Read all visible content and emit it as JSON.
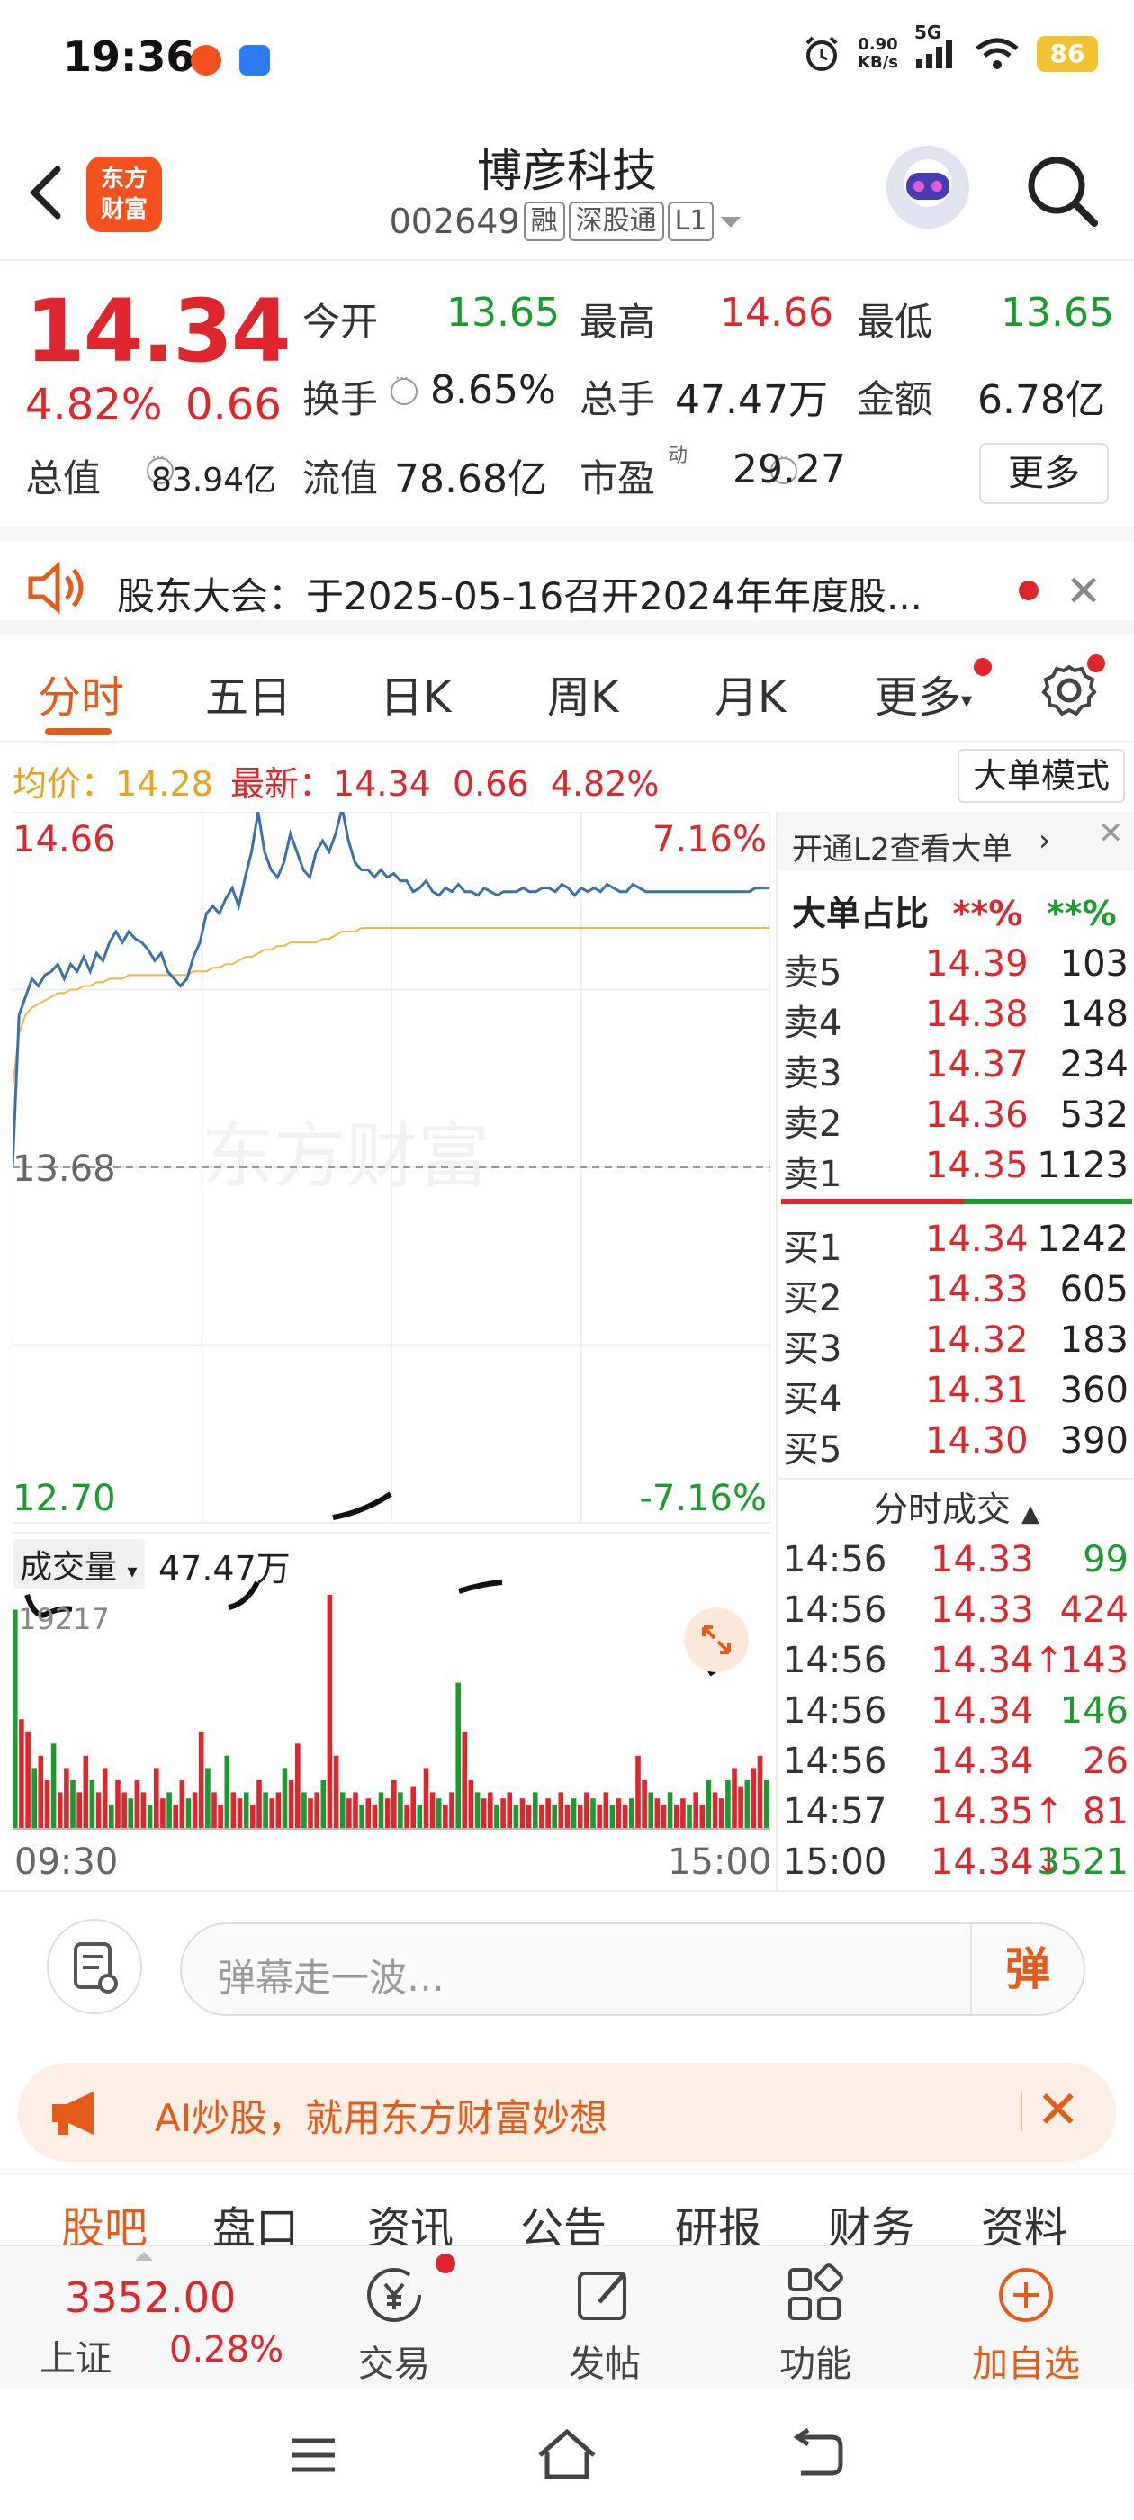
{
  "status_bar": {
    "time": "19:36",
    "net_speed_value": "0.90",
    "net_speed_unit": "KB/s",
    "network": "5G",
    "battery": "86"
  },
  "header": {
    "brand_line1": "东方",
    "brand_line2": "财富",
    "stock_name": "博彦科技",
    "stock_code": "002649",
    "tags": [
      "融",
      "深股通",
      "L1"
    ]
  },
  "quote": {
    "last_price": "14.34",
    "change_pct": "4.82%",
    "change_amt": "0.66",
    "open_label": "今开",
    "open_value": "13.65",
    "high_label": "最高",
    "high_value": "14.66",
    "low_label": "最低",
    "low_value": "13.65",
    "turnover_label": "换手",
    "turnover_value": "8.65%",
    "volume_label": "总手",
    "volume_value": "47.47万",
    "amount_label": "金额",
    "amount_value": "6.78亿",
    "mktcap_label": "总值",
    "mktcap_value": "83.94亿",
    "float_label": "流值",
    "float_value": "78.68亿",
    "pe_label": "市盈",
    "pe_sup": "动",
    "pe_value": "29.27",
    "more_label": "更多"
  },
  "notice": {
    "text": "股东大会：于2025-05-16召开2024年年度股..."
  },
  "period_tabs": [
    "分时",
    "五日",
    "日K",
    "周K",
    "月K",
    "更多"
  ],
  "avg_bar": {
    "avg_label": "均价：",
    "avg_value": "14.28",
    "latest_label": "最新：",
    "latest_value": "14.34",
    "latest_change": "0.66",
    "latest_pct": "4.82%",
    "mode_button": "大单模式"
  },
  "chart_data": {
    "type": "line",
    "price_axis": {
      "max": "14.66",
      "mid": "13.68",
      "min": "12.70",
      "max_pct": "7.16%",
      "min_pct": "-7.16%"
    },
    "ylim": [
      12.7,
      14.66
    ],
    "prev_close": 13.68,
    "time_axis": {
      "start": "09:30",
      "end": "15:00"
    },
    "watermark": "东方财富",
    "series": [
      {
        "values": [
          13.68,
          14.1,
          14.15,
          14.2,
          14.18,
          14.21,
          14.22,
          14.24,
          14.2,
          14.24,
          14.22,
          14.26,
          14.22,
          14.27,
          14.25,
          14.3,
          14.33,
          14.3,
          14.33,
          14.31,
          14.3,
          14.28,
          14.25,
          14.27,
          14.22,
          14.2,
          14.18,
          14.2,
          14.26,
          14.3,
          14.38,
          14.4,
          14.38,
          14.42,
          14.45,
          14.4,
          14.48,
          14.55,
          14.66,
          14.55,
          14.5,
          14.48,
          14.52,
          14.6,
          14.55,
          14.5,
          14.48,
          14.55,
          14.58,
          14.55,
          14.6,
          14.67,
          14.58,
          14.52,
          14.5,
          14.5,
          14.48,
          14.5,
          14.48,
          14.49,
          14.47,
          14.47,
          14.44,
          14.45,
          14.47,
          14.44,
          14.43,
          14.45,
          14.44,
          14.46,
          14.44,
          14.44,
          14.43,
          14.45,
          14.44,
          14.43,
          14.44,
          14.44,
          14.44,
          14.45,
          14.44,
          14.44,
          14.45,
          14.45,
          14.44,
          14.46,
          14.45,
          14.43,
          14.45,
          14.44,
          14.45,
          14.44,
          14.46,
          14.45,
          14.44,
          14.44,
          14.46,
          14.45,
          14.44,
          14.44,
          14.44,
          14.44,
          14.44,
          14.44,
          14.44,
          14.44,
          14.44,
          14.44,
          14.44,
          14.44,
          14.44,
          14.44,
          14.44,
          14.44,
          14.44,
          14.45,
          14.45,
          14.45
        ]
      },
      {
        "values": [
          13.9,
          14.05,
          14.1,
          14.12,
          14.13,
          14.14,
          14.15,
          14.16,
          14.16,
          14.17,
          14.17,
          14.18,
          14.18,
          14.19,
          14.19,
          14.2,
          14.2,
          14.2,
          14.21,
          14.21,
          14.21,
          14.21,
          14.21,
          14.21,
          14.21,
          14.21,
          14.21,
          14.21,
          14.22,
          14.22,
          14.22,
          14.23,
          14.23,
          14.24,
          14.24,
          14.25,
          14.26,
          14.26,
          14.27,
          14.28,
          14.28,
          14.29,
          14.29,
          14.3,
          14.3,
          14.3,
          14.3,
          14.3,
          14.31,
          14.31,
          14.32,
          14.33,
          14.33,
          14.33,
          14.34,
          14.34,
          14.34,
          14.34,
          14.34,
          14.34,
          14.34,
          14.34,
          14.34,
          14.34,
          14.34,
          14.34,
          14.34,
          14.34,
          14.34,
          14.34,
          14.34,
          14.34,
          14.34,
          14.34,
          14.34,
          14.34,
          14.34,
          14.34,
          14.34,
          14.34,
          14.34,
          14.34,
          14.34,
          14.34,
          14.34,
          14.34,
          14.34,
          14.34,
          14.34,
          14.34,
          14.34,
          14.34,
          14.34,
          14.34,
          14.34,
          14.34,
          14.34,
          14.34,
          14.34,
          14.34,
          14.34,
          14.34,
          14.34,
          14.34,
          14.34,
          14.34,
          14.34,
          14.34,
          14.34,
          14.34,
          14.34,
          14.34,
          14.34,
          14.34,
          14.34,
          14.34,
          14.34,
          14.34
        ]
      }
    ],
    "volume": {
      "label": "成交量",
      "total": "47.47万",
      "max_label": "19217",
      "max": 19217,
      "values": [
        18000,
        9000,
        8000,
        5000,
        6000,
        4000,
        7000,
        3000,
        5000,
        4000,
        3000,
        6000,
        4000,
        3000,
        5000,
        2000,
        4000,
        3000,
        2500,
        4000,
        3000,
        2000,
        5000,
        2500,
        3000,
        2000,
        4000,
        2500,
        3000,
        8000,
        5000,
        3000,
        2000,
        6000,
        3000,
        2500,
        3000,
        2000,
        4000,
        3000,
        2500,
        3000,
        5000,
        4000,
        7000,
        3000,
        2500,
        3000,
        4000,
        19217,
        6000,
        3000,
        2500,
        3000,
        2000,
        2500,
        2000,
        3000,
        2500,
        4000,
        3000,
        2000,
        3500,
        2000,
        5000,
        3000,
        2500,
        2000,
        3000,
        12000,
        8000,
        4000,
        3000,
        2500,
        3000,
        2000,
        2500,
        3000,
        2000,
        2500,
        2000,
        3000,
        2000,
        2500,
        2000,
        3000,
        2000,
        2500,
        2000,
        3000,
        2500,
        2000,
        3000,
        2000,
        2500,
        2000,
        2500,
        6000,
        4000,
        3000,
        2500,
        2000,
        3000,
        2000,
        2500,
        2000,
        3000,
        2000,
        4000,
        3000,
        2500,
        4000,
        5000,
        3500,
        4000,
        5000,
        6000,
        4000
      ]
    }
  },
  "order_book": {
    "l2_promo": "开通L2查看大单",
    "ratio_label": "大单占比",
    "ratio_sell": "**%",
    "ratio_buy": "**%",
    "asks": [
      {
        "label": "卖5",
        "price": "14.39",
        "vol": "103"
      },
      {
        "label": "卖4",
        "price": "14.38",
        "vol": "148"
      },
      {
        "label": "卖3",
        "price": "14.37",
        "vol": "234"
      },
      {
        "label": "卖2",
        "price": "14.36",
        "vol": "532"
      },
      {
        "label": "卖1",
        "price": "14.35",
        "vol": "1123"
      }
    ],
    "bids": [
      {
        "label": "买1",
        "price": "14.34",
        "vol": "1242"
      },
      {
        "label": "买2",
        "price": "14.33",
        "vol": "605"
      },
      {
        "label": "买3",
        "price": "14.32",
        "vol": "183"
      },
      {
        "label": "买4",
        "price": "14.31",
        "vol": "360"
      },
      {
        "label": "买5",
        "price": "14.30",
        "vol": "390"
      }
    ],
    "trades_title": "分时成交",
    "trades": [
      {
        "time": "14:56",
        "price": "14.33",
        "vol": "99"
      },
      {
        "time": "14:56",
        "price": "14.33",
        "vol": "424"
      },
      {
        "time": "14:56",
        "price": "14.34↑",
        "vol": "143"
      },
      {
        "time": "14:56",
        "price": "14.34",
        "vol": "146"
      },
      {
        "time": "14:56",
        "price": "14.34",
        "vol": "26"
      },
      {
        "time": "14:57",
        "price": "14.35↑",
        "vol": "81"
      },
      {
        "time": "15:00",
        "price": "14.34↓",
        "vol": "3521"
      }
    ]
  },
  "comment_bar": {
    "placeholder": "弹幕走一波…",
    "danmu_button": "弹"
  },
  "ai_banner": {
    "text": "AI炒股，就用东方财富妙想"
  },
  "content_tabs": [
    "股吧",
    "盘口",
    "资讯",
    "公告",
    "研报",
    "财务",
    "资料"
  ],
  "bottom_nav": {
    "index_value": "3352.00",
    "index_name": "上证",
    "index_change": "0.28%",
    "items": [
      "交易",
      "发帖",
      "功能",
      "加自选"
    ]
  },
  "colors": {
    "up": "#e0262d",
    "down": "#1a9a2f",
    "accent": "#e45b1a",
    "price_line": "#3d6fa7",
    "avg_line": "#e8b84a"
  }
}
